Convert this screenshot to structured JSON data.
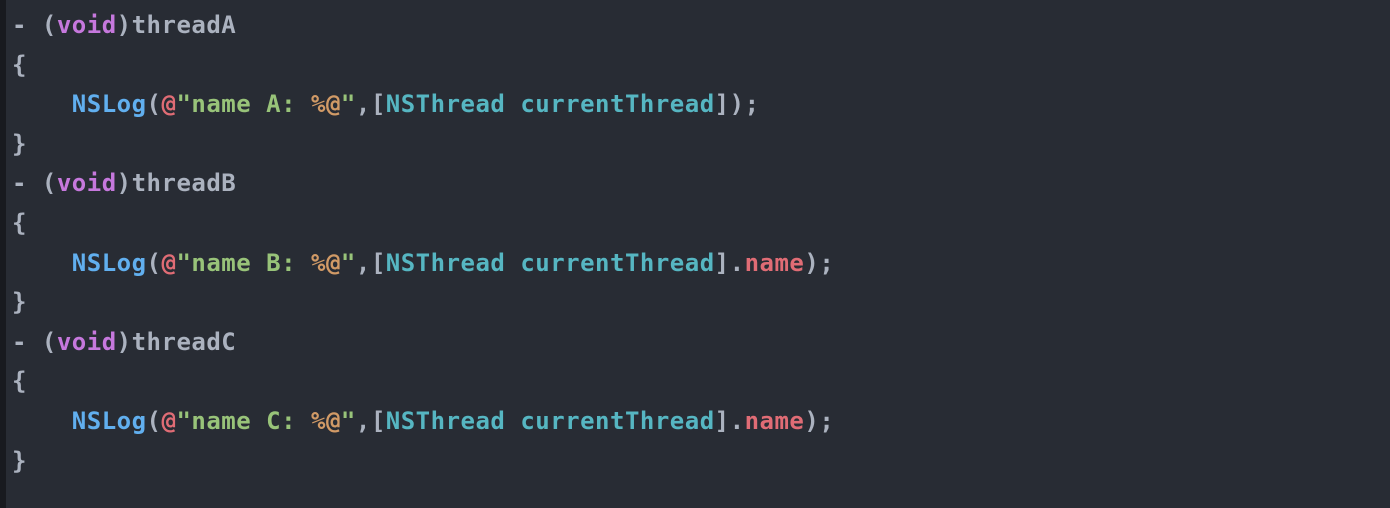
{
  "code": {
    "line1": {
      "dash": "- ",
      "lparen": "(",
      "void": "void",
      "rparen": ")",
      "name": "threadA"
    },
    "line2": {
      "brace": "{"
    },
    "line3": {
      "indent": "    ",
      "nslog": "NSLog",
      "lparen": "(",
      "at": "@",
      "q1": "\"",
      "str1": "name A: ",
      "fmt": "%@",
      "q2": "\"",
      "comma": ",",
      "lbrack": "[",
      "class": "NSThread",
      "space": " ",
      "method": "currentThread",
      "rbrack": "]",
      "rparen": ")",
      "semi": ";"
    },
    "line4": {
      "brace": "}"
    },
    "line5": {
      "dash": "- ",
      "lparen": "(",
      "void": "void",
      "rparen": ")",
      "name": "threadB"
    },
    "line6": {
      "brace": "{"
    },
    "line7": {
      "indent": "    ",
      "nslog": "NSLog",
      "lparen": "(",
      "at": "@",
      "q1": "\"",
      "str1": "name B: ",
      "fmt": "%@",
      "q2": "\"",
      "comma": ",",
      "lbrack": "[",
      "class": "NSThread",
      "space": " ",
      "method": "currentThread",
      "rbrack": "]",
      "dot": ".",
      "prop": "name",
      "rparen": ")",
      "semi": ";"
    },
    "line8": {
      "brace": "}"
    },
    "line9": {
      "dash": "- ",
      "lparen": "(",
      "void": "void",
      "rparen": ")",
      "name": "threadC"
    },
    "line10": {
      "brace": "{"
    },
    "line11": {
      "indent": "    ",
      "nslog": "NSLog",
      "lparen": "(",
      "at": "@",
      "q1": "\"",
      "str1": "name C: ",
      "fmt": "%@",
      "q2": "\"",
      "comma": ",",
      "lbrack": "[",
      "class": "NSThread",
      "space": " ",
      "method": "currentThread",
      "rbrack": "]",
      "dot": ".",
      "prop": "name",
      "rparen": ")",
      "semi": ";"
    },
    "line12": {
      "brace": "}"
    }
  }
}
